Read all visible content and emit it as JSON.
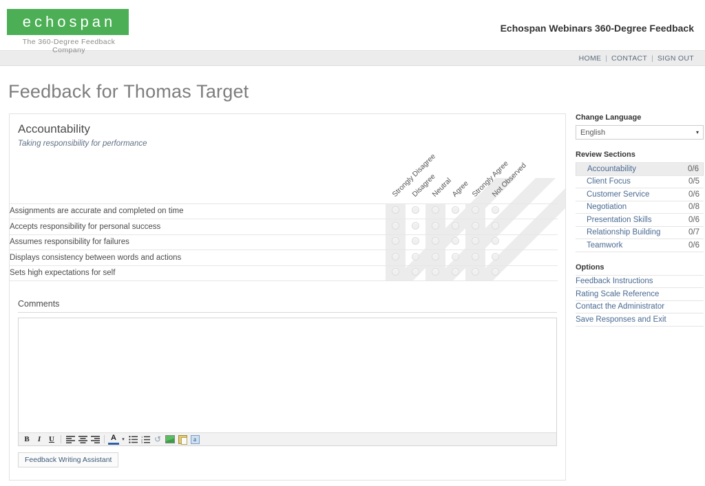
{
  "header": {
    "logo_text": "echospan",
    "logo_tagline": "The 360-Degree Feedback Company",
    "title": "Echospan Webinars 360-Degree Feedback",
    "brand_color": "#4caf56"
  },
  "nav": {
    "separator": "|",
    "items": [
      {
        "label": "HOME"
      },
      {
        "label": "CONTACT"
      },
      {
        "label": "SIGN OUT"
      }
    ]
  },
  "page": {
    "title": "Feedback for Thomas Target"
  },
  "section": {
    "title": "Accountability",
    "subtitle": "Taking responsibility for performance"
  },
  "rating": {
    "scale": [
      "Strongly Disagree",
      "Disagree",
      "Neutral",
      "Agree",
      "Strongly Agree",
      "Not Observed"
    ],
    "questions": [
      "Assignments are accurate and completed on time",
      "Accepts responsibility for personal success",
      "Assumes responsibility for failures",
      "Displays consistency between words and actions",
      "Sets high expectations for self"
    ]
  },
  "comments": {
    "label": "Comments",
    "value": "",
    "placeholder": ""
  },
  "toolbar": {
    "bold": "B",
    "italic": "I",
    "underline": "U",
    "font_color": "A",
    "caret": "▾",
    "align_left_icon": "align-left-icon",
    "align_center_icon": "align-center-icon",
    "align_right_icon": "align-right-icon",
    "bullet_list_icon": "bullet-list-icon",
    "numbered_list_icon": "numbered-list-icon",
    "undo": "↺",
    "image_icon": "image-icon",
    "paste_icon": "paste-icon",
    "spellcheck": "a"
  },
  "assistant": {
    "label": "Feedback Writing Assistant"
  },
  "sidebar": {
    "language_heading": "Change Language",
    "language_value": "English",
    "language_caret": "▾",
    "sections_heading": "Review Sections",
    "sections": [
      {
        "label": "Accountability",
        "count": "0/6",
        "active": true
      },
      {
        "label": "Client Focus",
        "count": "0/5",
        "active": false
      },
      {
        "label": "Customer Service",
        "count": "0/6",
        "active": false
      },
      {
        "label": "Negotiation",
        "count": "0/8",
        "active": false
      },
      {
        "label": "Presentation Skills",
        "count": "0/6",
        "active": false
      },
      {
        "label": "Relationship Building",
        "count": "0/7",
        "active": false
      },
      {
        "label": "Teamwork",
        "count": "0/6",
        "active": false
      }
    ],
    "options_heading": "Options",
    "options": [
      {
        "label": "Feedback Instructions"
      },
      {
        "label": "Rating Scale Reference"
      },
      {
        "label": "Contact the Administrator"
      },
      {
        "label": "Save Responses and Exit"
      }
    ]
  }
}
